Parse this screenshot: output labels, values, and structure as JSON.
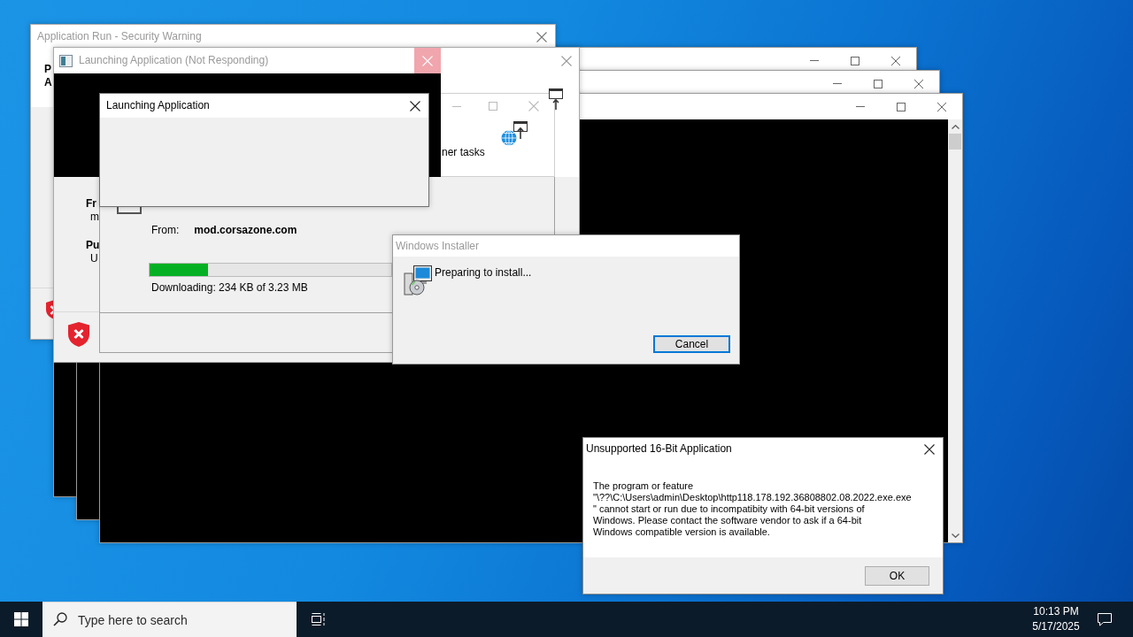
{
  "background_windows": [
    {
      "kind": "console"
    },
    {
      "kind": "console"
    },
    {
      "kind": "console"
    }
  ],
  "security_warning": {
    "title": "Application Run - Security Warning",
    "active": false,
    "labels": [
      "P",
      "A"
    ]
  },
  "launching_ghost": {
    "title": "Launching Application (Not Responding)",
    "active": false,
    "close_hover": true,
    "task_text": "ner tasks",
    "stale_labels": [
      {
        "label": "Fr",
        "value": "m"
      },
      {
        "label": "Pu",
        "value": "U"
      }
    ],
    "from_label": "From:",
    "from_value": "mod.corsazone.com",
    "progress": {
      "level": 0.24
    },
    "status": "Downloading: 234 KB of 3.23 MB"
  },
  "launching_dialog": {
    "title": "Launching Application",
    "active": true
  },
  "windows_installer": {
    "title": "Windows Installer",
    "active": false,
    "message": "Preparing to install...",
    "buttons": [
      {
        "label": "Cancel",
        "default": true
      }
    ]
  },
  "unsupported_dialog": {
    "title": "Unsupported 16-Bit Application",
    "active": true,
    "message": "The program or feature\n\"\\??\\C:\\Users\\admin\\Desktop\\http118.178.192.36808802.08.2022.exe.exe\n\" cannot start or run due to incompatibity with 64-bit versions of\nWindows. Please contact the software vendor to ask if a 64-bit\nWindows compatible version is available.",
    "buttons": [
      {
        "label": "OK",
        "default": false
      }
    ]
  },
  "taskbar": {
    "search": {
      "placeholder": "Type here to search"
    },
    "clock": {
      "time": "10:13 PM",
      "date": "5/17/2025"
    }
  }
}
